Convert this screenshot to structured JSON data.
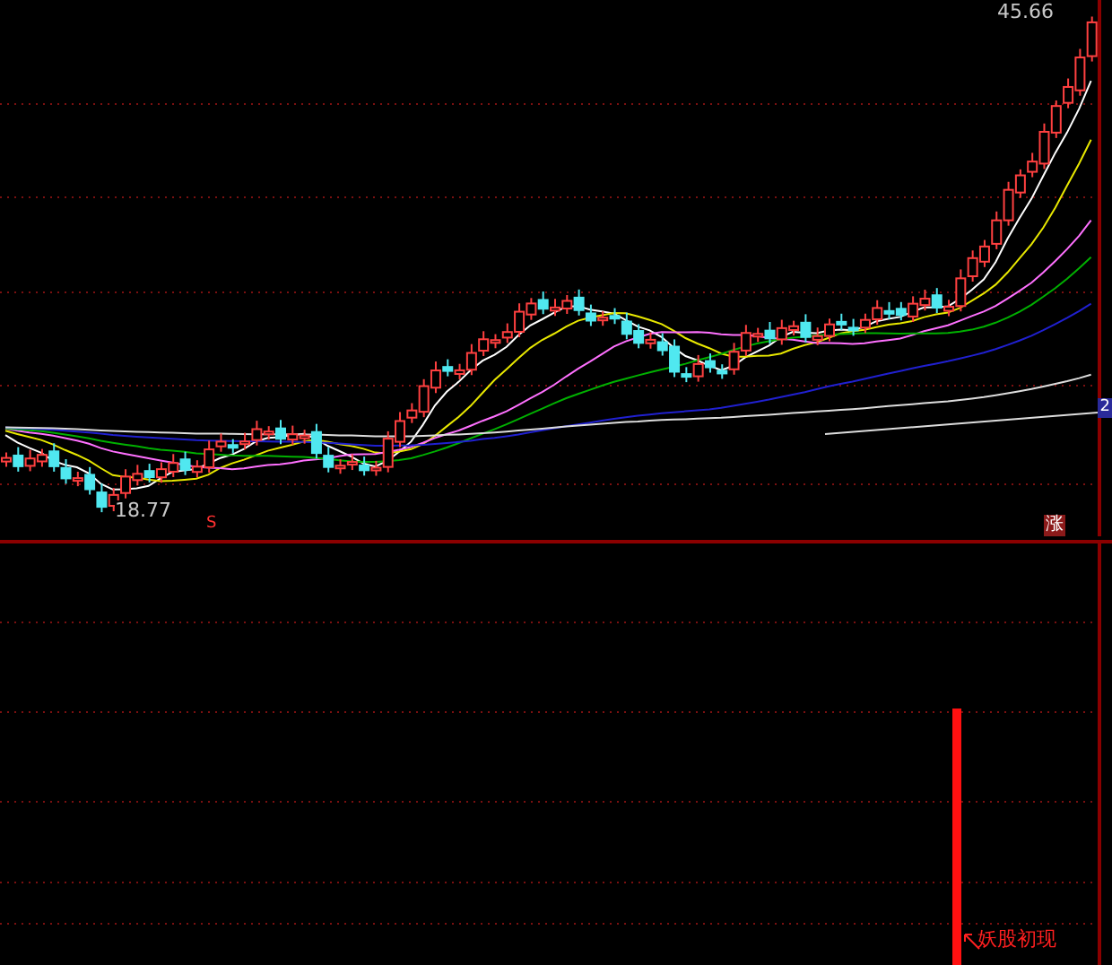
{
  "price_chart": {
    "high_label": "45.66",
    "low_label": "18.77",
    "signal_marker": "S",
    "rise_marker": "涨",
    "axis_badge": "2"
  },
  "indicator_panel": {
    "signal_label": "妖股初现"
  }
}
